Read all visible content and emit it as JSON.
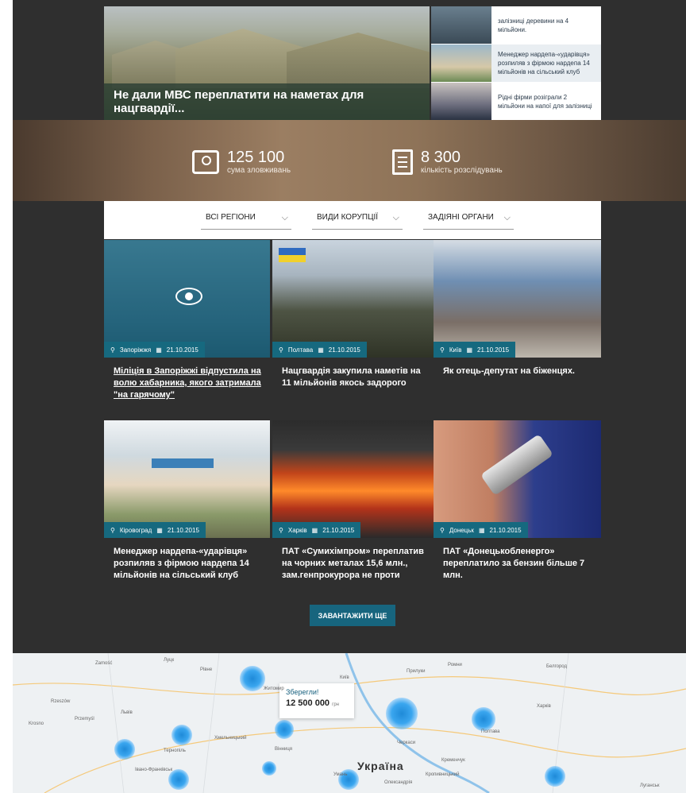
{
  "hero": {
    "main_caption": "Не дали МВС переплатити на наметах для нацгвардії...",
    "side": [
      {
        "text": "залізниці деревини на 4 мільйони."
      },
      {
        "text": "Менеджер нардепа-«ударівця» розпиляв з фірмою нардепа 14 мільйонів на сільський клуб"
      },
      {
        "text": "Рідні фірми розіграли 2 мільйони на напої для залізниці"
      }
    ]
  },
  "stats": [
    {
      "value": "125 100",
      "label": "сума зловживань",
      "icon": "money-icon"
    },
    {
      "value": "8 300",
      "label": "кількість розслідувань",
      "icon": "document-icon"
    }
  ],
  "filters": [
    {
      "label": "Всі регіони"
    },
    {
      "label": "Види корупції"
    },
    {
      "label": "Задіяні органи"
    }
  ],
  "cards": [
    {
      "region": "Запоріжжя",
      "date": "21.10.2015",
      "title": "Міліція в Запоріжжі відпустила на волю хабарника, якого затримала \"на гарячому\""
    },
    {
      "region": "Полтава",
      "date": "21.10.2015",
      "title": "Нацгвардія закупила наметів на 11 мільйонів якось задорого"
    },
    {
      "region": "Київ",
      "date": "21.10.2015",
      "title": "Як отець-депутат на біженцях."
    },
    {
      "region": "Кіровоград",
      "date": "21.10.2015",
      "title": "Менеджер нардепа-«ударівця» розпиляв з фірмою нардепа 14 мільйонів на сільський клуб"
    },
    {
      "region": "Харків",
      "date": "21.10.2015",
      "title": "ПАТ «Сумихімпром» переплатив на чорних металах 15,6 млн., зам.генпрокурора не проти"
    },
    {
      "region": "Донецьк",
      "date": "21.10.2015",
      "title": "ПАТ «Донецькобленерго» переплатило за бензин більше 7 млн."
    }
  ],
  "load_more": "Завантажити ще",
  "map": {
    "tooltip_title": "Зберегли!",
    "tooltip_value": "12 500 000",
    "tooltip_unit": "грн",
    "country": "Україна",
    "labels": [
      "Zamość",
      "Луцк",
      "Рівне",
      "Житомир",
      "Київ",
      "Прилуки",
      "Ромни",
      "Белгород",
      "Львів",
      "Хмельницький",
      "Тернопіль",
      "Вінниця",
      "Черкаси",
      "Полтава",
      "Харків",
      "Кременчук",
      "Умань",
      "Кропивницький",
      "Олександрія",
      "Івано-Франківськ",
      "Луганськ",
      "Rzeszów",
      "Krosno",
      "Przemyśl"
    ]
  }
}
